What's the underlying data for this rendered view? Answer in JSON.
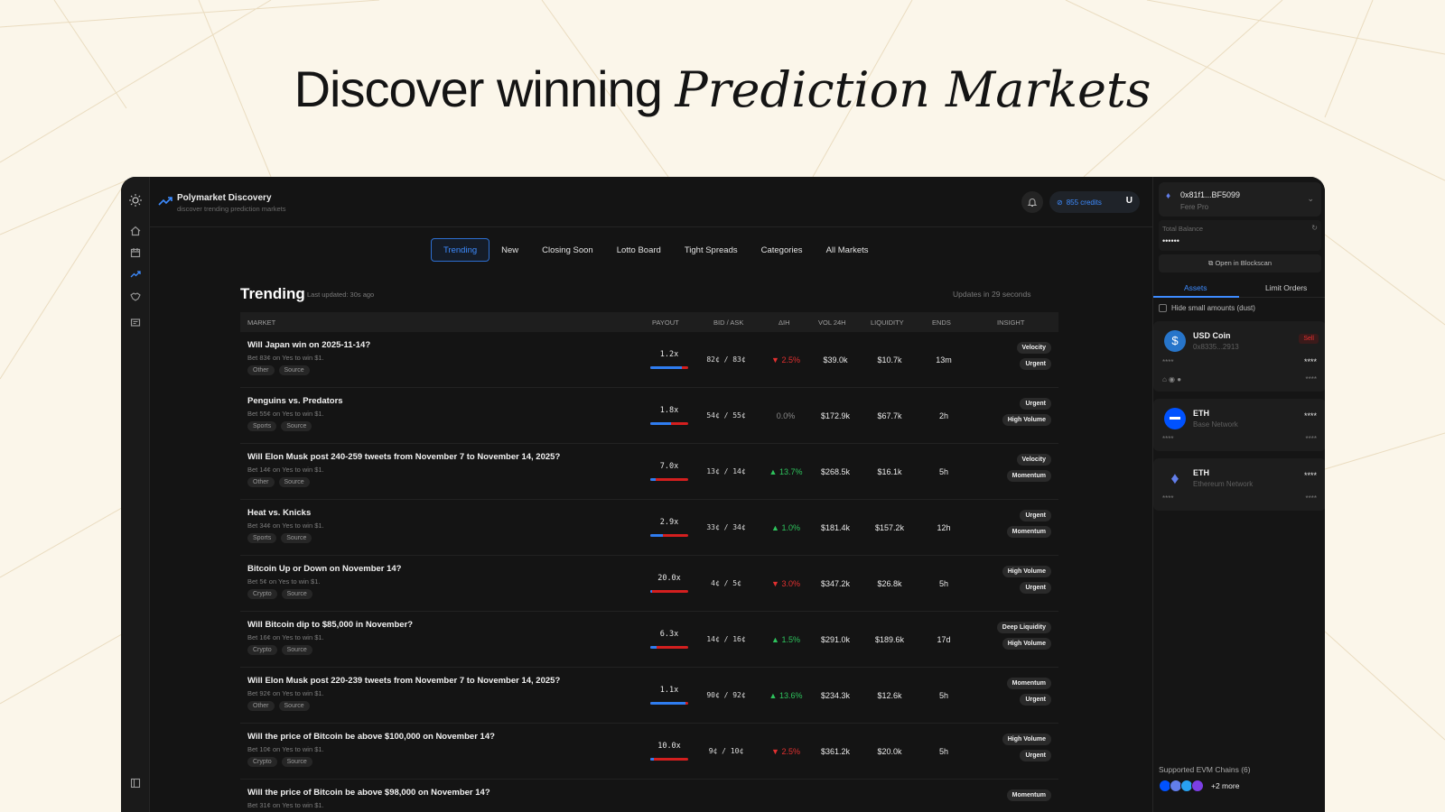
{
  "headline": {
    "plain": "Discover winning ",
    "italic": "Prediction Markets"
  },
  "app": {
    "title": "Polymarket Discovery",
    "subtitle": "discover trending prediction markets",
    "credits": "855 credits",
    "user_initial": "U"
  },
  "tabs": [
    "Trending",
    "New",
    "Closing Soon",
    "Lotto Board",
    "Tight Spreads",
    "Categories",
    "All Markets"
  ],
  "active_tab": "Trending",
  "section": {
    "title": "Trending",
    "last_updated": "Last updated: 30s ago",
    "updates_in": "Updates in 29 seconds"
  },
  "columns": {
    "market": "MARKET",
    "payout": "PAYOUT",
    "bid_ask": "BID / ASK",
    "delta": "ΔIH",
    "vol": "VOL 24H",
    "liquidity": "LIQUIDITY",
    "ends": "ENDS",
    "insight": "INSIGHT"
  },
  "rows": [
    {
      "question": "Will Japan win on 2025-11-14?",
      "bet": "Bet 83¢ on Yes to win $1.",
      "tags": [
        "Other",
        "Source"
      ],
      "payout": "1.2x",
      "payout_fill": 0.83,
      "bid_ask": "82¢ / 83¢",
      "change": "▼ 2.5%",
      "dir": "down",
      "vol": "$39.0k",
      "liq": "$10.7k",
      "ends": "13m",
      "insights": [
        "Velocity",
        "Urgent"
      ]
    },
    {
      "question": "Penguins vs. Predators",
      "bet": "Bet 55¢ on Yes to win $1.",
      "tags": [
        "Sports",
        "Source"
      ],
      "payout": "1.8x",
      "payout_fill": 0.55,
      "bid_ask": "54¢ / 55¢",
      "change": "0.0%",
      "dir": "flat",
      "vol": "$172.9k",
      "liq": "$67.7k",
      "ends": "2h",
      "insights": [
        "Urgent",
        "High Volume"
      ]
    },
    {
      "question": "Will Elon Musk post 240-259 tweets from November 7 to November 14, 2025?",
      "bet": "Bet 14¢ on Yes to win $1.",
      "tags": [
        "Other",
        "Source"
      ],
      "payout": "7.0x",
      "payout_fill": 0.14,
      "bid_ask": "13¢ / 14¢",
      "change": "▲ 13.7%",
      "dir": "up",
      "vol": "$268.5k",
      "liq": "$16.1k",
      "ends": "5h",
      "insights": [
        "Velocity",
        "Momentum"
      ]
    },
    {
      "question": "Heat vs. Knicks",
      "bet": "Bet 34¢ on Yes to win $1.",
      "tags": [
        "Sports",
        "Source"
      ],
      "payout": "2.9x",
      "payout_fill": 0.34,
      "bid_ask": "33¢ / 34¢",
      "change": "▲ 1.0%",
      "dir": "up",
      "vol": "$181.4k",
      "liq": "$157.2k",
      "ends": "12h",
      "insights": [
        "Urgent",
        "Momentum"
      ]
    },
    {
      "question": "Bitcoin Up or Down on November 14?",
      "bet": "Bet 5¢ on Yes to win $1.",
      "tags": [
        "Crypto",
        "Source"
      ],
      "payout": "20.0x",
      "payout_fill": 0.05,
      "bid_ask": "4¢ / 5¢",
      "change": "▼ 3.0%",
      "dir": "down",
      "vol": "$347.2k",
      "liq": "$26.8k",
      "ends": "5h",
      "insights": [
        "High Volume",
        "Urgent"
      ]
    },
    {
      "question": "Will Bitcoin dip to $85,000 in November?",
      "bet": "Bet 16¢ on Yes to win $1.",
      "tags": [
        "Crypto",
        "Source"
      ],
      "payout": "6.3x",
      "payout_fill": 0.16,
      "bid_ask": "14¢ / 16¢",
      "change": "▲ 1.5%",
      "dir": "up",
      "vol": "$291.0k",
      "liq": "$189.6k",
      "ends": "17d",
      "insights": [
        "Deep Liquidity",
        "High Volume"
      ]
    },
    {
      "question": "Will Elon Musk post 220-239 tweets from November 7 to November 14, 2025?",
      "bet": "Bet 92¢ on Yes to win $1.",
      "tags": [
        "Other",
        "Source"
      ],
      "payout": "1.1x",
      "payout_fill": 0.92,
      "bid_ask": "90¢ / 92¢",
      "change": "▲ 13.6%",
      "dir": "up",
      "vol": "$234.3k",
      "liq": "$12.6k",
      "ends": "5h",
      "insights": [
        "Momentum",
        "Urgent"
      ]
    },
    {
      "question": "Will the price of Bitcoin be above $100,000 on November 14?",
      "bet": "Bet 10¢ on Yes to win $1.",
      "tags": [
        "Crypto",
        "Source"
      ],
      "payout": "10.0x",
      "payout_fill": 0.1,
      "bid_ask": "9¢ / 10¢",
      "change": "▼ 2.5%",
      "dir": "down",
      "vol": "$361.2k",
      "liq": "$20.0k",
      "ends": "5h",
      "insights": [
        "High Volume",
        "Urgent"
      ]
    },
    {
      "question": "Will the price of Bitcoin be above $98,000 on November 14?",
      "bet": "Bet 31¢ on Yes to win $1.",
      "tags": [],
      "payout": "",
      "payout_fill": 0.31,
      "bid_ask": "",
      "change": "",
      "dir": "flat",
      "vol": "",
      "liq": "",
      "ends": "",
      "insights": [
        "Momentum"
      ]
    }
  ],
  "wallet": {
    "address": "0x81f1...BF5099",
    "plan": "Fere Pro",
    "balance_label": "Total Balance",
    "balance_value": "••••••",
    "open_button": "Open in Blockscan",
    "tab_assets": "Assets",
    "tab_limit": "Limit Orders",
    "hide_label": "Hide small amounts (dust)"
  },
  "assets": [
    {
      "name": "USD Coin",
      "sub": "0x8335...2913",
      "value": "****",
      "left": "****",
      "right": "****",
      "sell": "Sell",
      "color": "#2775ca"
    },
    {
      "name": "ETH",
      "sub": "Base Network",
      "value": "****",
      "left": "****",
      "right": "****",
      "color": "#0052ff"
    },
    {
      "name": "ETH",
      "sub": "Ethereum Network",
      "value": "****",
      "left": "****",
      "right": "****",
      "color": "#627eea"
    }
  ],
  "chains": {
    "label": "Supported EVM Chains (6)",
    "more": "+2 more"
  }
}
